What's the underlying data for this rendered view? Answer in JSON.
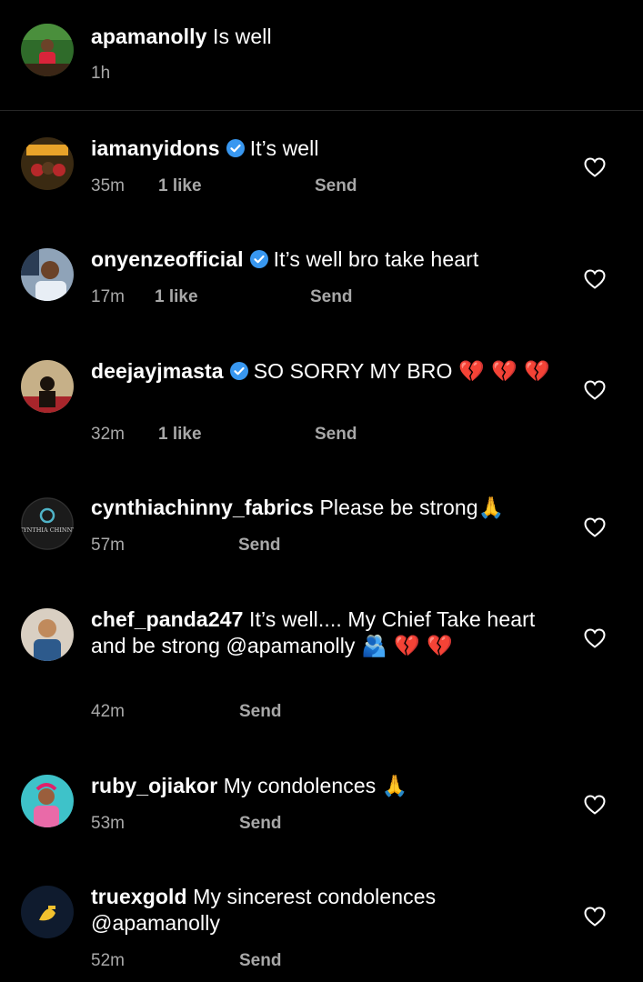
{
  "comments": [
    {
      "username": "apamanolly",
      "verified": false,
      "text": "Is well",
      "time": "1h",
      "likes": "",
      "reply": "",
      "heart": false
    },
    {
      "username": "iamanyidons",
      "verified": true,
      "text": "It’s well",
      "time": "35m",
      "likes": "1 like",
      "reply": "Send",
      "heart": true
    },
    {
      "username": "onyenzeofficial",
      "verified": true,
      "text": "It’s well bro take heart",
      "time": "17m",
      "likes": "1 like",
      "reply": "Send",
      "heart": true
    },
    {
      "username": "deejayjmasta",
      "verified": true,
      "text": "SO SORRY MY BRO",
      "emoji": "💔 💔 💔",
      "time": "32m",
      "likes": "1 like",
      "reply": "Send",
      "heart": true
    },
    {
      "username": "cynthiachinny_fabrics",
      "verified": false,
      "text": "Please be strong",
      "emoji": "🙏",
      "time": "57m",
      "likes": "",
      "reply": "Send",
      "heart": true
    },
    {
      "username": "chef_panda247",
      "verified": false,
      "text": "It’s well.... My Chief Take heart and be strong @apamanolly",
      "emoji": "🫂 💔 💔",
      "time": "42m",
      "likes": "",
      "reply": "Send",
      "heart": true
    },
    {
      "username": "ruby_ojiakor",
      "verified": false,
      "text": "My condolences",
      "emoji": "🙏",
      "time": "53m",
      "likes": "",
      "reply": "Send",
      "heart": true
    },
    {
      "username": "truexgold",
      "verified": false,
      "text": "My sincerest condolences @apamanolly",
      "time": "52m",
      "likes": "",
      "reply": "Send",
      "heart": true
    }
  ],
  "avatar_logo_text": {
    "c4": "CYNTHIA CHINNY"
  },
  "icons": {
    "verified": "verified-badge-icon",
    "heart": "heart-outline-icon"
  },
  "colors": {
    "background": "#000000",
    "secondary_text": "#a8a8a8",
    "verified": "#3897f0",
    "heartbreak": "#e0202f"
  }
}
